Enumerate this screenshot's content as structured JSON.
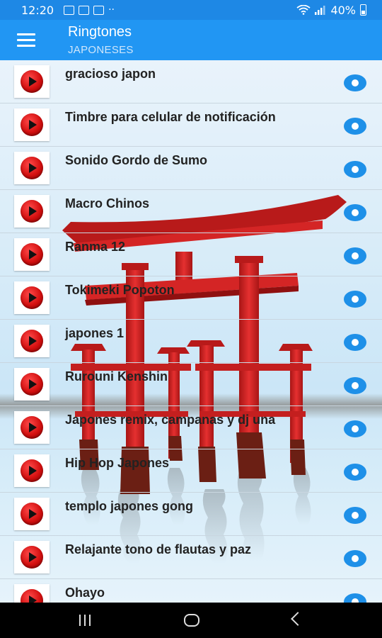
{
  "status": {
    "time": "12:20",
    "battery": "40%"
  },
  "appbar": {
    "title": "Ringtones",
    "subtitle": "JAPONESES"
  },
  "ringtones": [
    {
      "label": "gracioso japon"
    },
    {
      "label": "Timbre para celular de notificación"
    },
    {
      "label": "Sonido Gordo de Sumo"
    },
    {
      "label": "Macro Chinos"
    },
    {
      "label": "Ranma 12"
    },
    {
      "label": "Tokimeki Popoton"
    },
    {
      "label": "japones 1"
    },
    {
      "label": "Rurouni Kenshin"
    },
    {
      "label": "Japones remix, campanas y dj una"
    },
    {
      "label": "Hip Hop Japones"
    },
    {
      "label": "templo japones gong"
    },
    {
      "label": "Relajante tono de flautas y paz"
    },
    {
      "label": "Ohayo"
    }
  ],
  "colors": {
    "appbar": "#2196f3",
    "statusbar": "#1e88e5",
    "radio": "#1e90e8",
    "torii": "#d42525"
  }
}
